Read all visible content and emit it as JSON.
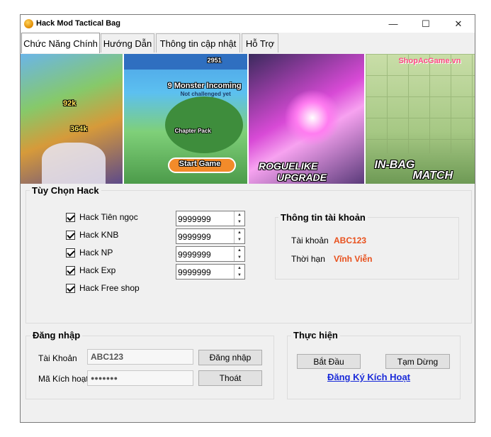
{
  "window": {
    "title": "Hack Mod Tactical Bag",
    "minimize": "—",
    "maximize": "☐",
    "close": "✕"
  },
  "tabs": [
    {
      "label": "Chức Năng Chính"
    },
    {
      "label": "Hướng Dẫn"
    },
    {
      "label": "Thông tin cập nhật"
    },
    {
      "label": "Hỗ Trợ"
    }
  ],
  "banner": {
    "p1_numbers": [
      "92k",
      "364k"
    ],
    "p2_title": "9 Monster Incoming",
    "p2_sub": "Not challenged yet",
    "p2_score": "2951",
    "p2_chapter": "Chapter Pack",
    "p2_start": "Start Game",
    "p3_line1": "ROGUELIKE",
    "p3_line2": "UPGRADE",
    "p4_watermark": "ShopAcGame.vn",
    "p4_line1": "IN-BAG",
    "p4_line2": "MATCH"
  },
  "hack_options": {
    "legend": "Tùy Chọn Hack",
    "items": [
      {
        "label": "Hack Tiên ngọc",
        "value": "9999999"
      },
      {
        "label": "Hack KNB",
        "value": "9999999"
      },
      {
        "label": "Hack NP",
        "value": "9999999"
      },
      {
        "label": "Hack Exp",
        "value": "9999999"
      },
      {
        "label": "Hack Free shop"
      }
    ]
  },
  "account_info": {
    "legend": "Thông tin tài khoản",
    "account_label": "Tài khoản",
    "account_value": "ABC123",
    "duration_label": "Thời hạn",
    "duration_value": "Vĩnh Viễn"
  },
  "login": {
    "legend": "Đăng nhập",
    "account_label": "Tài Khoản",
    "account_value": "ABC123",
    "code_label": "Mã Kích hoạt",
    "code_value": "●●●●●●●",
    "login_button": "Đăng nhập",
    "exit_button": "Thoát"
  },
  "execute": {
    "legend": "Thực hiện",
    "start_button": "Bắt Đầu",
    "pause_button": "Tạm Dừng",
    "register_link": "Đăng Ký Kích Hoạt"
  },
  "colors": {
    "accent_red": "#e8501c",
    "link_blue": "#1a2bd9"
  }
}
